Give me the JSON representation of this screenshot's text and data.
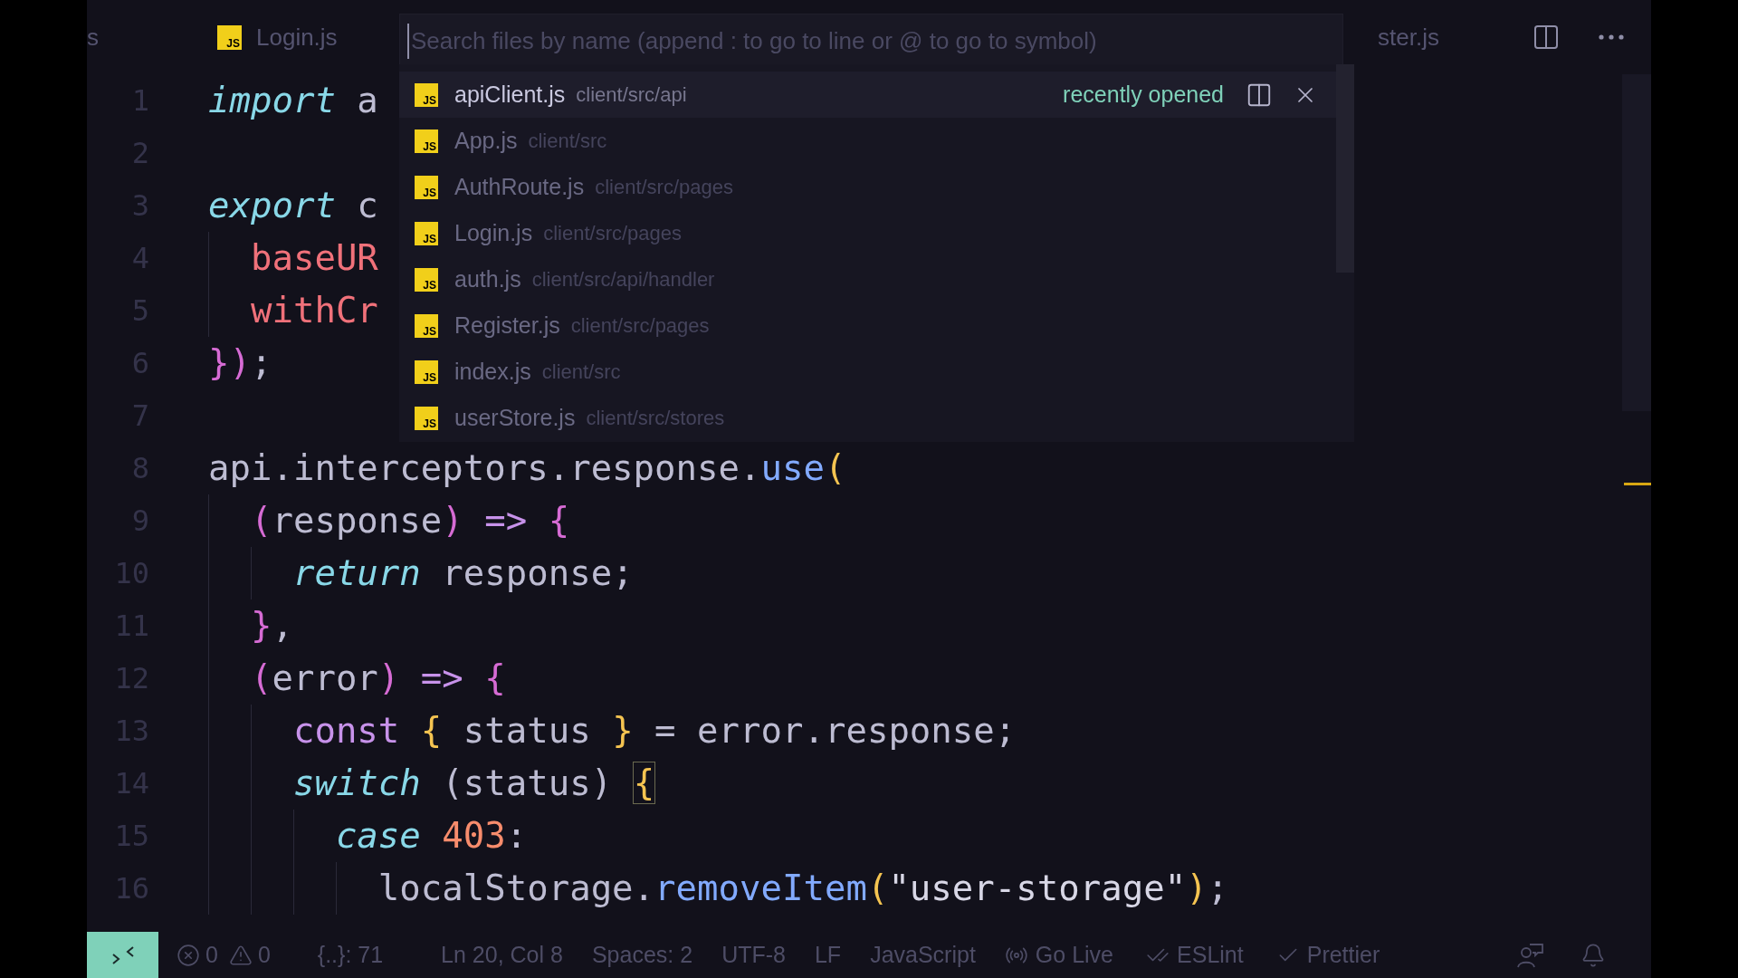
{
  "tabs": [
    {
      "label": "s",
      "kind": "clipped"
    },
    {
      "label": "Login.js",
      "kind": "js-file",
      "icon_label": "JS"
    },
    {
      "label": "ster.js",
      "kind": "clipped"
    }
  ],
  "code_lines": [
    {
      "number": "1",
      "tokens": [
        {
          "text": "import",
          "kind": "keyword"
        },
        {
          "text": " a",
          "kind": "plain"
        }
      ]
    },
    {
      "number": "2"
    },
    {
      "number": "3",
      "tokens": [
        {
          "text": "export",
          "kind": "keyword"
        },
        {
          "text": " c",
          "kind": "plain"
        }
      ]
    },
    {
      "number": "4",
      "tokens": [
        {
          "text": "  baseUR",
          "kind": "property"
        }
      ]
    },
    {
      "number": "5",
      "tokens": [
        {
          "text": "  withCr",
          "kind": "property"
        }
      ]
    },
    {
      "number": "6",
      "tokens": [
        {
          "text": "}",
          "kind": "bracket2"
        },
        {
          "text": ")",
          "kind": "bracket2"
        },
        {
          "text": ";",
          "kind": "plain"
        }
      ]
    },
    {
      "number": "7"
    },
    {
      "number": "8",
      "tokens": [
        {
          "text": "api.interceptors.response.",
          "kind": "plain"
        },
        {
          "text": "use",
          "kind": "func"
        },
        {
          "text": "(",
          "kind": "bracket1"
        }
      ]
    },
    {
      "number": "9",
      "tokens": [
        {
          "text": "  (",
          "kind": "bracket2"
        },
        {
          "text": "response",
          "kind": "plain"
        },
        {
          "text": ")",
          "kind": "bracket2"
        },
        {
          "text": " => ",
          "kind": "operator"
        },
        {
          "text": "{",
          "kind": "bracket2"
        }
      ]
    },
    {
      "number": "10",
      "tokens": [
        {
          "text": "    return",
          "kind": "keyword"
        },
        {
          "text": " response;",
          "kind": "plain"
        }
      ]
    },
    {
      "number": "11",
      "tokens": [
        {
          "text": "  }",
          "kind": "bracket2"
        },
        {
          "text": ",",
          "kind": "plain"
        }
      ]
    },
    {
      "number": "12",
      "tokens": [
        {
          "text": "  (",
          "kind": "bracket2"
        },
        {
          "text": "error",
          "kind": "plain"
        },
        {
          "text": ")",
          "kind": "bracket2"
        },
        {
          "text": " => ",
          "kind": "operator"
        },
        {
          "text": "{",
          "kind": "bracket2"
        }
      ]
    },
    {
      "number": "13",
      "tokens": [
        {
          "text": "    const",
          "kind": "storage"
        },
        {
          "text": " {",
          "kind": "bracket1"
        },
        {
          "text": " status ",
          "kind": "plain"
        },
        {
          "text": "}",
          "kind": "bracket1"
        },
        {
          "text": " = error.response;",
          "kind": "plain"
        }
      ]
    },
    {
      "number": "14",
      "tokens": [
        {
          "text": "    switch",
          "kind": "keyword"
        },
        {
          "text": " (status) ",
          "kind": "plain"
        },
        {
          "text": "{",
          "kind": "bracket-match"
        }
      ]
    },
    {
      "number": "15",
      "tokens": [
        {
          "text": "      case",
          "kind": "keyword"
        },
        {
          "text": " 403",
          "kind": "number"
        },
        {
          "text": ":",
          "kind": "plain"
        }
      ]
    },
    {
      "number": "16",
      "tokens": [
        {
          "text": "        localStorage.",
          "kind": "plain"
        },
        {
          "text": "removeItem",
          "kind": "func"
        },
        {
          "text": "(",
          "kind": "bracket1"
        },
        {
          "text": "\"user-storage\"",
          "kind": "string"
        },
        {
          "text": ")",
          "kind": "bracket1"
        },
        {
          "text": ";",
          "kind": "plain"
        }
      ]
    }
  ],
  "quick_open": {
    "placeholder": "Search files by name (append : to go to line or @ to go to symbol)",
    "items": [
      {
        "name": "apiClient.js",
        "path": "client/src/api",
        "selected": true,
        "note": "recently opened",
        "icon_label": "JS"
      },
      {
        "name": "App.js",
        "path": "client/src",
        "selected": false,
        "icon_label": "JS"
      },
      {
        "name": "AuthRoute.js",
        "path": "client/src/pages",
        "selected": false,
        "icon_label": "JS"
      },
      {
        "name": "Login.js",
        "path": "client/src/pages",
        "selected": false,
        "icon_label": "JS"
      },
      {
        "name": "auth.js",
        "path": "client/src/api/handler",
        "selected": false,
        "icon_label": "JS"
      },
      {
        "name": "Register.js",
        "path": "client/src/pages",
        "selected": false,
        "icon_label": "JS"
      },
      {
        "name": "index.js",
        "path": "client/src",
        "selected": false,
        "icon_label": "JS"
      },
      {
        "name": "userStore.js",
        "path": "client/src/stores",
        "selected": false,
        "icon_label": "JS"
      }
    ]
  },
  "status_bar": {
    "errors": "0",
    "warnings": "0",
    "items": [
      "{..}: 71",
      "Ln 20, Col 8",
      "Spaces: 2",
      "UTF-8",
      "LF",
      "JavaScript"
    ],
    "go_live": "Go Live",
    "eslint": "ESLint",
    "prettier": "Prettier"
  }
}
